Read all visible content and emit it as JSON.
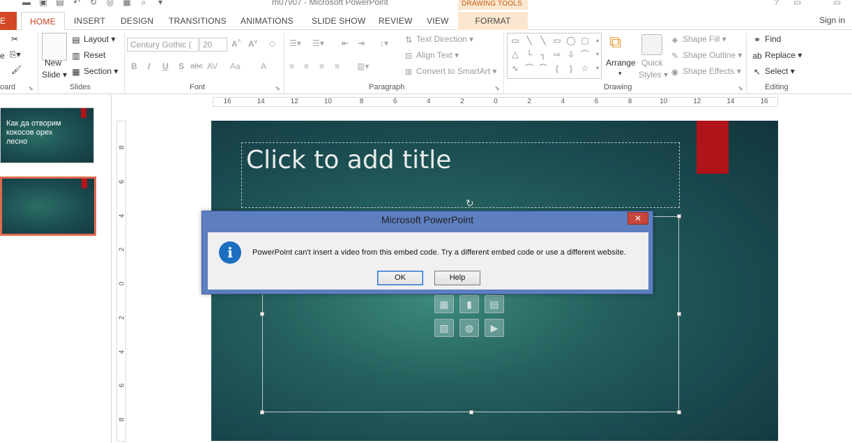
{
  "window": {
    "title": "m07v07 - Microsoft PowerPoint",
    "contextual_tab_group": "DRAWING TOOLS",
    "sign_in": "Sign in",
    "help": "?"
  },
  "tabs": {
    "file": "E",
    "home": "HOME",
    "insert": "INSERT",
    "design": "DESIGN",
    "transitions": "TRANSITIONS",
    "animations": "ANIMATIONS",
    "slide_show": "SLIDE SHOW",
    "review": "REVIEW",
    "view": "VIEW",
    "format": "FORMAT"
  },
  "ribbon": {
    "clipboard": {
      "label": "oard",
      "paste": "e"
    },
    "slides": {
      "label": "Slides",
      "new_slide_1": "New",
      "new_slide_2": "Slide",
      "layout": "Layout",
      "reset": "Reset",
      "section": "Section"
    },
    "font": {
      "label": "Font",
      "font_name": "Century Gothic (",
      "font_size": "20",
      "bold": "B",
      "italic": "I",
      "underline": "U",
      "shadow": "S",
      "strike": "abc",
      "spacing": "AV",
      "case": "Aa",
      "color": "A"
    },
    "paragraph": {
      "label": "Paragraph",
      "text_direction": "Text Direction",
      "align_text": "Align Text",
      "convert_smartart": "Convert to SmartArt"
    },
    "drawing": {
      "label": "Drawing",
      "arrange": "Arrange",
      "quick_styles_1": "Quick",
      "quick_styles_2": "Styles",
      "shape_fill": "Shape Fill",
      "shape_outline": "Shape Outline",
      "shape_effects": "Shape Effects"
    },
    "editing": {
      "label": "Editing",
      "find": "Find",
      "replace": "Replace",
      "select": "Select"
    }
  },
  "thumbnails": [
    {
      "text": "Как да отворим кокосов орех лесно",
      "selected": false
    },
    {
      "text": "",
      "selected": true
    }
  ],
  "hruler_labels": [
    "16",
    "14",
    "12",
    "10",
    "8",
    "6",
    "4",
    "2",
    "0",
    "2",
    "4",
    "6",
    "8",
    "10",
    "12",
    "14",
    "16"
  ],
  "vruler_labels": [
    "8",
    "6",
    "4",
    "2",
    "0",
    "2",
    "4",
    "6",
    "8"
  ],
  "slide": {
    "title_placeholder": "Click to add title"
  },
  "dialog": {
    "title": "Microsoft PowerPoint",
    "close": "✕",
    "message": "PowerPoint can't insert a video from this embed code. Try a different embed code or use a different website.",
    "ok": "OK",
    "help": "Help"
  },
  "colors": {
    "accent": "#d24726",
    "dialog_frame": "#5d7fc0",
    "slide_flag": "#b0141a"
  }
}
